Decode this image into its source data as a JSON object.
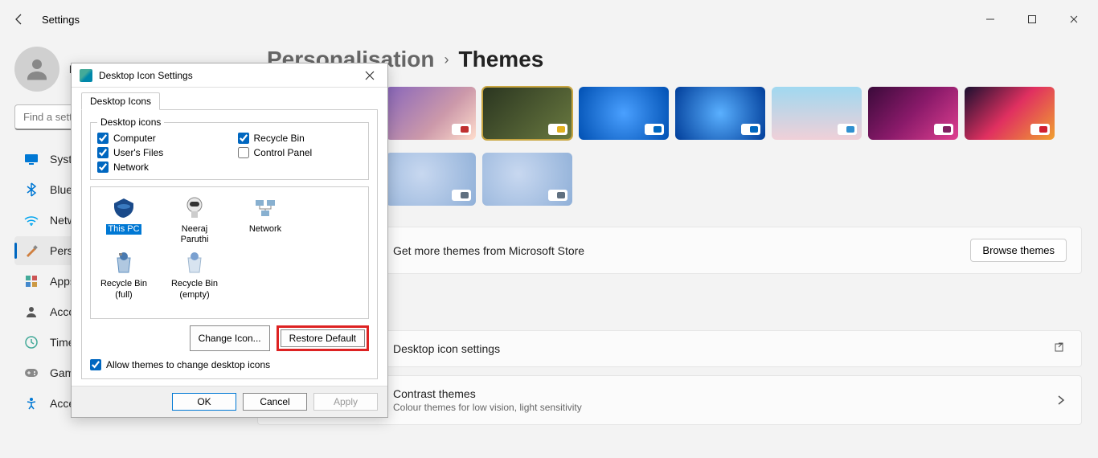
{
  "window": {
    "title": "Settings"
  },
  "user": {
    "name": "Neeraj Paruthi"
  },
  "search": {
    "placeholder": "Find a setting"
  },
  "nav": [
    {
      "id": "system",
      "label": "System"
    },
    {
      "id": "bluetooth",
      "label": "Bluetooth & devices"
    },
    {
      "id": "network",
      "label": "Network & internet"
    },
    {
      "id": "personalisation",
      "label": "Personalisation",
      "active": true
    },
    {
      "id": "apps",
      "label": "Apps"
    },
    {
      "id": "accounts",
      "label": "Accounts"
    },
    {
      "id": "time",
      "label": "Time & language"
    },
    {
      "id": "gaming",
      "label": "Gaming"
    },
    {
      "id": "accessibility",
      "label": "Accessibility"
    }
  ],
  "breadcrumb": {
    "root": "Personalisation",
    "leaf": "Themes"
  },
  "themes_store": {
    "text": "Get more themes from Microsoft Store",
    "button": "Browse themes"
  },
  "related": {
    "title": "Desktop icon settings"
  },
  "contrast": {
    "title": "Contrast themes",
    "sub": "Colour themes for low vision, light sensitivity"
  },
  "dialog": {
    "title": "Desktop Icon Settings",
    "tab": "Desktop Icons",
    "group": "Desktop icons",
    "checks": {
      "computer": "Computer",
      "users_files": "User's Files",
      "network": "Network",
      "recycle_bin": "Recycle Bin",
      "control_panel": "Control Panel"
    },
    "check_state": {
      "computer": true,
      "users_files": true,
      "network": true,
      "recycle_bin": true,
      "control_panel": false
    },
    "icons": [
      {
        "label": "This PC",
        "selected": true
      },
      {
        "label": "Neeraj Paruthi"
      },
      {
        "label": "Network"
      },
      {
        "label": "Recycle Bin (full)"
      },
      {
        "label": "Recycle Bin (empty)"
      }
    ],
    "change_icon": "Change Icon...",
    "restore_default": "Restore Default",
    "allow_themes": "Allow themes to change desktop icons",
    "ok": "OK",
    "cancel": "Cancel",
    "apply": "Apply"
  },
  "theme_cards": [
    {
      "bg": "linear-gradient(135deg,#86b 0%,#c9a 60%,#fdc 100%)",
      "accent": "#c03030"
    },
    {
      "bg": "linear-gradient(135deg,#2a3520,#6a7a40)",
      "accent": "#e0b020",
      "selected": true
    },
    {
      "bg": "radial-gradient(circle at 50% 50%, #4aa0ff, #0050b3)",
      "accent": "#0067c0"
    },
    {
      "bg": "radial-gradient(circle at 50% 50%, #5ab0ff, #003d99)",
      "accent": "#0067c0"
    },
    {
      "bg": "linear-gradient(180deg,#a0d8f0,#f0d0d8)",
      "accent": "#3090d0"
    },
    {
      "bg": "linear-gradient(135deg,#3a0a3a,#8a1a6a,#e04090)",
      "accent": "#802060"
    },
    {
      "bg": "linear-gradient(135deg,#1a1030,#e03060,#f0a030)",
      "accent": "#d02030"
    },
    {
      "bg": "radial-gradient(circle at 40% 40%, #c8d8f0, #90b0d8)",
      "accent": "#607080",
      "row2": true
    },
    {
      "bg": "radial-gradient(circle at 40% 40%, #c8d8f0, #90b0d8)",
      "accent": "#607080",
      "row2": true
    }
  ]
}
